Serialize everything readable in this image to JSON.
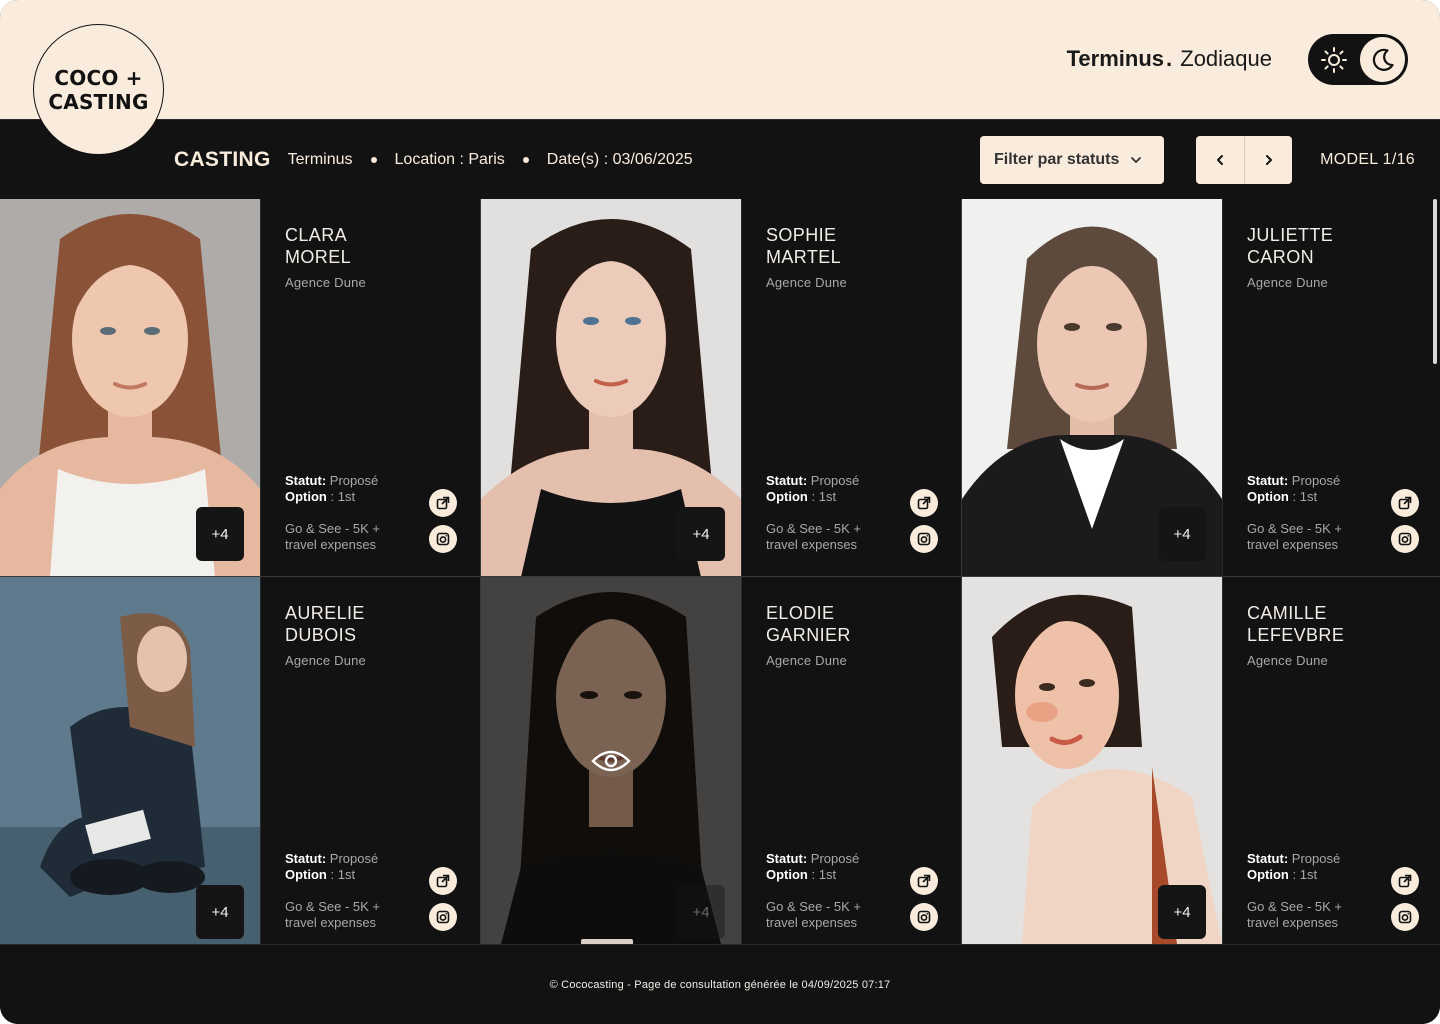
{
  "brand": {
    "line1": "COCO +",
    "line2": "CASTING"
  },
  "project": {
    "client": "Terminus",
    "separator": ".",
    "name": "Zodiaque"
  },
  "theme": {
    "current": "dark",
    "light_icon": "sun-icon",
    "dark_icon": "moon-icon"
  },
  "subbar": {
    "section": "CASTING",
    "client": "Terminus",
    "location": "Location : Paris",
    "dates": "Date(s) : 03/06/2025",
    "filter_label": "Filter par statuts",
    "model_counter": "MODEL 1/16"
  },
  "models": [
    {
      "first": "CLARA",
      "last": "MOREL",
      "agency": "Agence Dune",
      "status_label": "Statut:",
      "status_value": "Proposé",
      "option_label": "Option",
      "option_value": ": 1st",
      "fee": "Go & See - 5K + travel expenses",
      "more": "+4"
    },
    {
      "first": "SOPHIE",
      "last": "MARTEL",
      "agency": "Agence Dune",
      "status_label": "Statut:",
      "status_value": "Proposé",
      "option_label": "Option",
      "option_value": ": 1st",
      "fee": "Go & See - 5K + travel expenses",
      "more": "+4"
    },
    {
      "first": "JULIETTE",
      "last": "CARON",
      "agency": "Agence Dune",
      "status_label": "Statut:",
      "status_value": "Proposé",
      "option_label": "Option",
      "option_value": ": 1st",
      "fee": "Go & See - 5K + travel expenses",
      "more": "+4"
    },
    {
      "first": "AURELIE",
      "last": "DUBOIS",
      "agency": "Agence Dune",
      "status_label": "Statut:",
      "status_value": "Proposé",
      "option_label": "Option",
      "option_value": ": 1st",
      "fee": "Go & See - 5K + travel expenses",
      "more": "+4"
    },
    {
      "first": "ELODIE",
      "last": "GARNIER",
      "agency": "Agence Dune",
      "status_label": "Statut:",
      "status_value": "Proposé",
      "option_label": "Option",
      "option_value": ": 1st",
      "fee": "Go & See - 5K + travel expenses",
      "more": "+4"
    },
    {
      "first": "CAMILLE",
      "last": "LEFEVBRE",
      "agency": "Agence Dune",
      "status_label": "Statut:",
      "status_value": "Proposé",
      "option_label": "Option",
      "option_value": ": 1st",
      "fee": "Go & See - 5K + travel expenses",
      "more": "+4"
    }
  ],
  "footer": {
    "text": "© Cococasting - Page de consultation générée le 04/09/2025 07:17"
  },
  "colors": {
    "cream": "#f9ecdd",
    "dark": "#121212",
    "muted_text": "#a8a8a8"
  }
}
